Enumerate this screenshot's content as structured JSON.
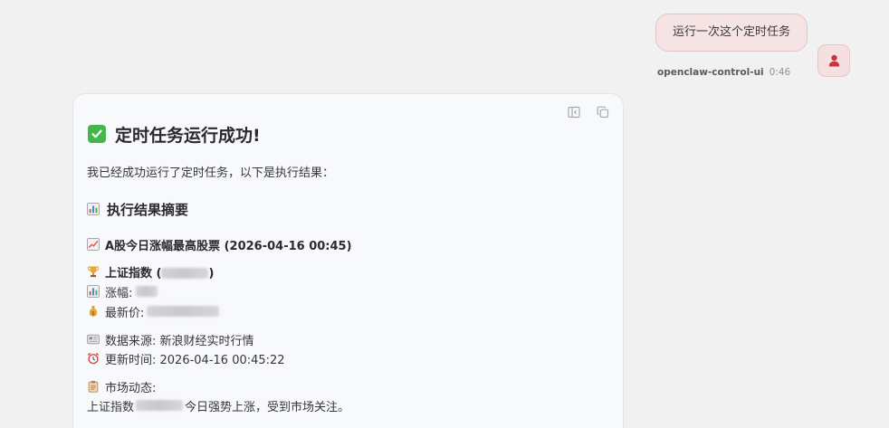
{
  "user_message": {
    "text": "运行一次这个定时任务",
    "sender": "openclaw-control-ui",
    "time": "0:46"
  },
  "assistant": {
    "title": "定时任务运行成功!",
    "intro": "我已经成功运行了定时任务，以下是执行结果：",
    "summary_heading": "执行结果摘要",
    "stock_heading": "A股今日涨幅最高股票 (2026-04-16 00:45)",
    "index_label_prefix": "上证指数 (",
    "index_label_suffix": ")",
    "change_label": "涨幅:",
    "price_label": "最新价:",
    "source_label": "数据来源: 新浪财经实时行情",
    "update_label": "更新时间: 2026-04-16 00:45:22",
    "market_label": "市场动态:",
    "market_text_prefix": "上证指数",
    "market_text_suffix": "今日强势上涨，受到市场关注。"
  },
  "icons": {
    "title": "check-mark-icon",
    "summary": "bar-chart-icon",
    "stock": "chart-up-icon",
    "index": "trophy-icon",
    "change": "bar-chart-icon",
    "price": "money-bag-icon",
    "source": "newspaper-icon",
    "update": "alarm-clock-icon",
    "market": "clipboard-icon",
    "tools": [
      "side-panel-icon",
      "copy-icon"
    ]
  },
  "colors": {
    "user_bubble": "#f6e3e4",
    "avatar_icon": "#c8363d",
    "check": "#43b74a",
    "card_bg": "#f8f9fa"
  }
}
